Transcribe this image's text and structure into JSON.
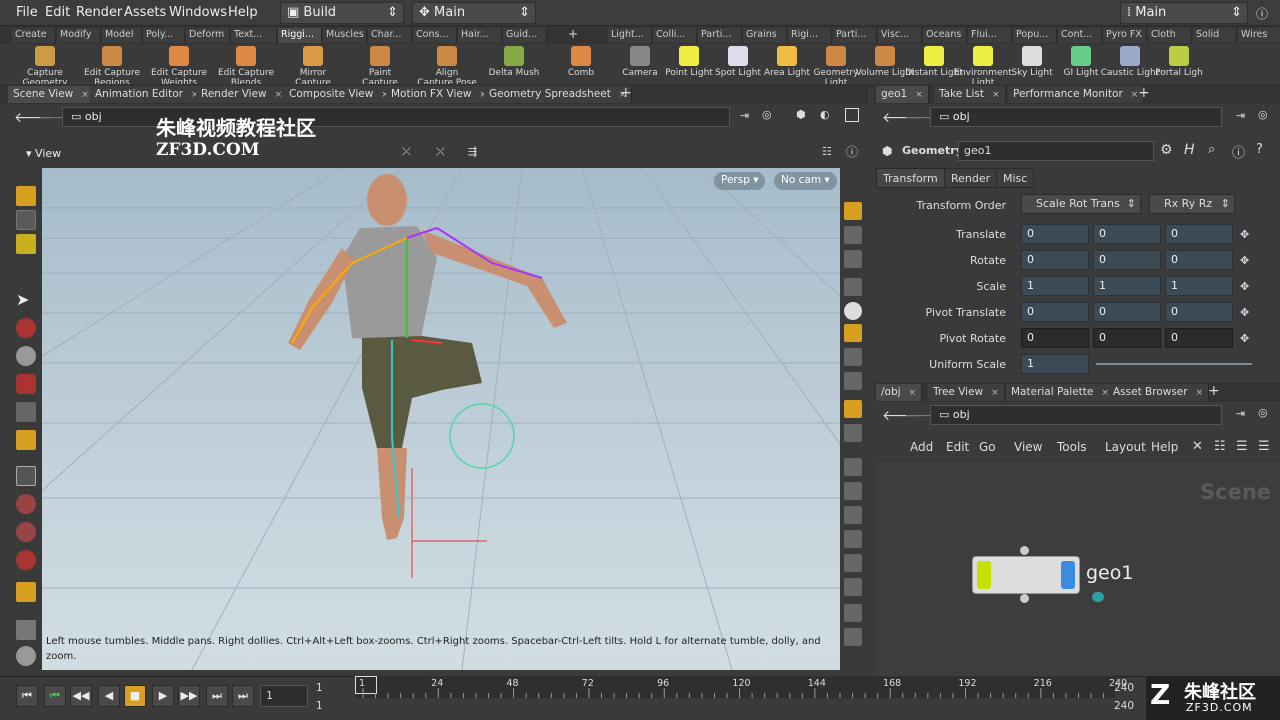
{
  "menu": {
    "file": "File",
    "edit": "Edit",
    "render": "Render",
    "assets": "Assets",
    "windows": "Windows",
    "help": "Help"
  },
  "desktop": {
    "build": "Build",
    "main": "Main",
    "main_right": "Main"
  },
  "shelf_tabs_left": [
    "Create",
    "Modify",
    "Model",
    "Poly...",
    "Deform",
    "Text...",
    "Riggi...",
    "Muscles",
    "Char...",
    "Cons...",
    "Hair...",
    "Guid..."
  ],
  "shelf_tabs_right": [
    "Light...",
    "Colli...",
    "Parti...",
    "Grains",
    "Rigi...",
    "Parti...",
    "Visc...",
    "Oceans",
    "Flui...",
    "Popu...",
    "Cont...",
    "Pyro FX",
    "Cloth",
    "Solid",
    "Wires"
  ],
  "tools_left": [
    {
      "l1": "Capture",
      "l2": "Geometry"
    },
    {
      "l1": "Edit Capture",
      "l2": "Regions"
    },
    {
      "l1": "Edit Capture",
      "l2": "Weights"
    },
    {
      "l1": "Edit Capture",
      "l2": "Blends"
    },
    {
      "l1": "Mirror Capture",
      "l2": "Weights"
    },
    {
      "l1": "Paint",
      "l2": "Capture Layer"
    },
    {
      "l1": "Align",
      "l2": "Capture Pose"
    },
    {
      "l1": "Delta Mush",
      "l2": ""
    },
    {
      "l1": "Comb",
      "l2": ""
    }
  ],
  "tools_right": [
    {
      "l1": "Camera",
      "l2": ""
    },
    {
      "l1": "Point Light",
      "l2": ""
    },
    {
      "l1": "Spot Light",
      "l2": ""
    },
    {
      "l1": "Area Light",
      "l2": ""
    },
    {
      "l1": "Geometry",
      "l2": "Light"
    },
    {
      "l1": "Volume Light",
      "l2": ""
    },
    {
      "l1": "Distant Light",
      "l2": ""
    },
    {
      "l1": "Environment",
      "l2": "Light"
    },
    {
      "l1": "Sky Light",
      "l2": ""
    },
    {
      "l1": "GI Light",
      "l2": ""
    },
    {
      "l1": "Caustic Light",
      "l2": ""
    },
    {
      "l1": "Portal Ligh",
      "l2": ""
    }
  ],
  "pane_tabs_left": [
    "Scene View",
    "Animation Editor",
    "Render View",
    "Composite View",
    "Motion FX View",
    "Geometry Spreadsheet"
  ],
  "pane_tabs_right_top": [
    "geo1",
    "Take List",
    "Performance Monitor"
  ],
  "pane_tabs_right_bottom": [
    "/obj",
    "Tree View",
    "Material Palette",
    "Asset Browser"
  ],
  "path": {
    "left": "obj",
    "right_top": "obj",
    "right_bottom": "obj"
  },
  "watermark": {
    "cn": "朱峰视频教程社区",
    "en": "ZF3D.COM",
    "corner_cn": "朱峰社区",
    "corner_en": "ZF3D.COM"
  },
  "viewport": {
    "label": "View",
    "persp": "Persp",
    "cam": "No cam",
    "status": "Left mouse tumbles. Middle pans. Right dollies. Ctrl+Alt+Left box-zooms. Ctrl+Right zooms. Spacebar-Ctrl-Left tilts. Hold L for alternate tumble, dolly, and zoom."
  },
  "params": {
    "type": "Geometry",
    "name": "geo1",
    "tabs": [
      "Transform",
      "Render",
      "Misc"
    ],
    "transform_order_label": "Transform Order",
    "transform_order": "Scale Rot Trans",
    "rot_order": "Rx Ry Rz",
    "rows": [
      {
        "label": "Translate",
        "v": [
          "0",
          "0",
          "0"
        ]
      },
      {
        "label": "Rotate",
        "v": [
          "0",
          "0",
          "0"
        ]
      },
      {
        "label": "Scale",
        "v": [
          "1",
          "1",
          "1"
        ]
      },
      {
        "label": "Pivot Translate",
        "v": [
          "0",
          "0",
          "0"
        ]
      },
      {
        "label": "Pivot Rotate",
        "v": [
          "0",
          "0",
          "0"
        ]
      },
      {
        "label": "Uniform Scale",
        "v": [
          "1"
        ]
      }
    ]
  },
  "network": {
    "menu": [
      "Add",
      "Edit",
      "Go",
      "View",
      "Tools",
      "Layout",
      "Help"
    ],
    "context": "Scene",
    "node": "geo1"
  },
  "timeline": {
    "frame": "1",
    "start": "1",
    "start2": "1",
    "end": "240",
    "end2": "240",
    "ticks": [
      "1",
      "24",
      "48",
      "72",
      "96",
      "120",
      "144",
      "168",
      "192",
      "216",
      "240"
    ]
  },
  "colors": {
    "accent": "#e0a000",
    "node_left": "#c8e000",
    "node_right": "#3a8ce0"
  }
}
